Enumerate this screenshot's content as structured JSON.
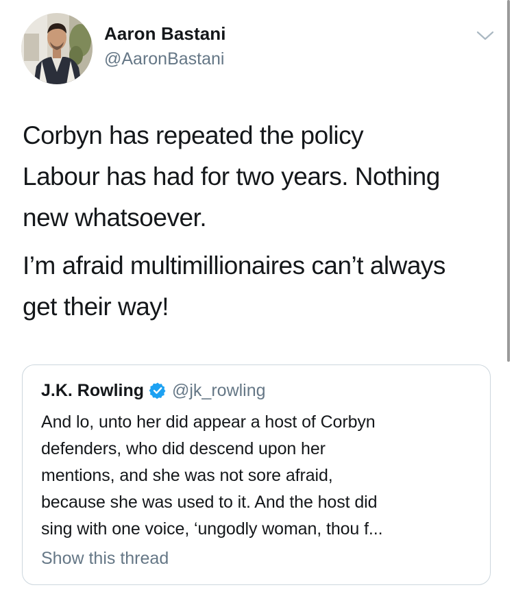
{
  "author": {
    "display_name": "Aaron Bastani",
    "handle": "@AaronBastani",
    "avatar_icon": "profile-photo-avatar"
  },
  "menu": {
    "icon": "chevron-down-icon"
  },
  "tweet": {
    "paragraph_1_lines": [
      "Corbyn has repeated the policy",
      "Labour has had for two years. Nothing",
      "new whatsoever."
    ],
    "paragraph_2_lines": [
      "I’m afraid multimillionaires can’t always",
      "get their way!"
    ]
  },
  "quoted_tweet": {
    "display_name": "J.K. Rowling",
    "verified_icon": "verified-badge-icon",
    "handle": "@jk_rowling",
    "lines": [
      "And lo, unto her did appear a host of Corbyn",
      "defenders, who did descend upon her",
      "mentions, and she was not sore afraid,",
      "because she was used to it. And the host did",
      "sing with one voice, ‘ungodly woman, thou f..."
    ],
    "show_thread_label": "Show this thread"
  },
  "colors": {
    "text_primary": "#14171a",
    "text_secondary": "#657786",
    "border": "#ccd6dd",
    "verified_blue": "#1da1f2"
  }
}
